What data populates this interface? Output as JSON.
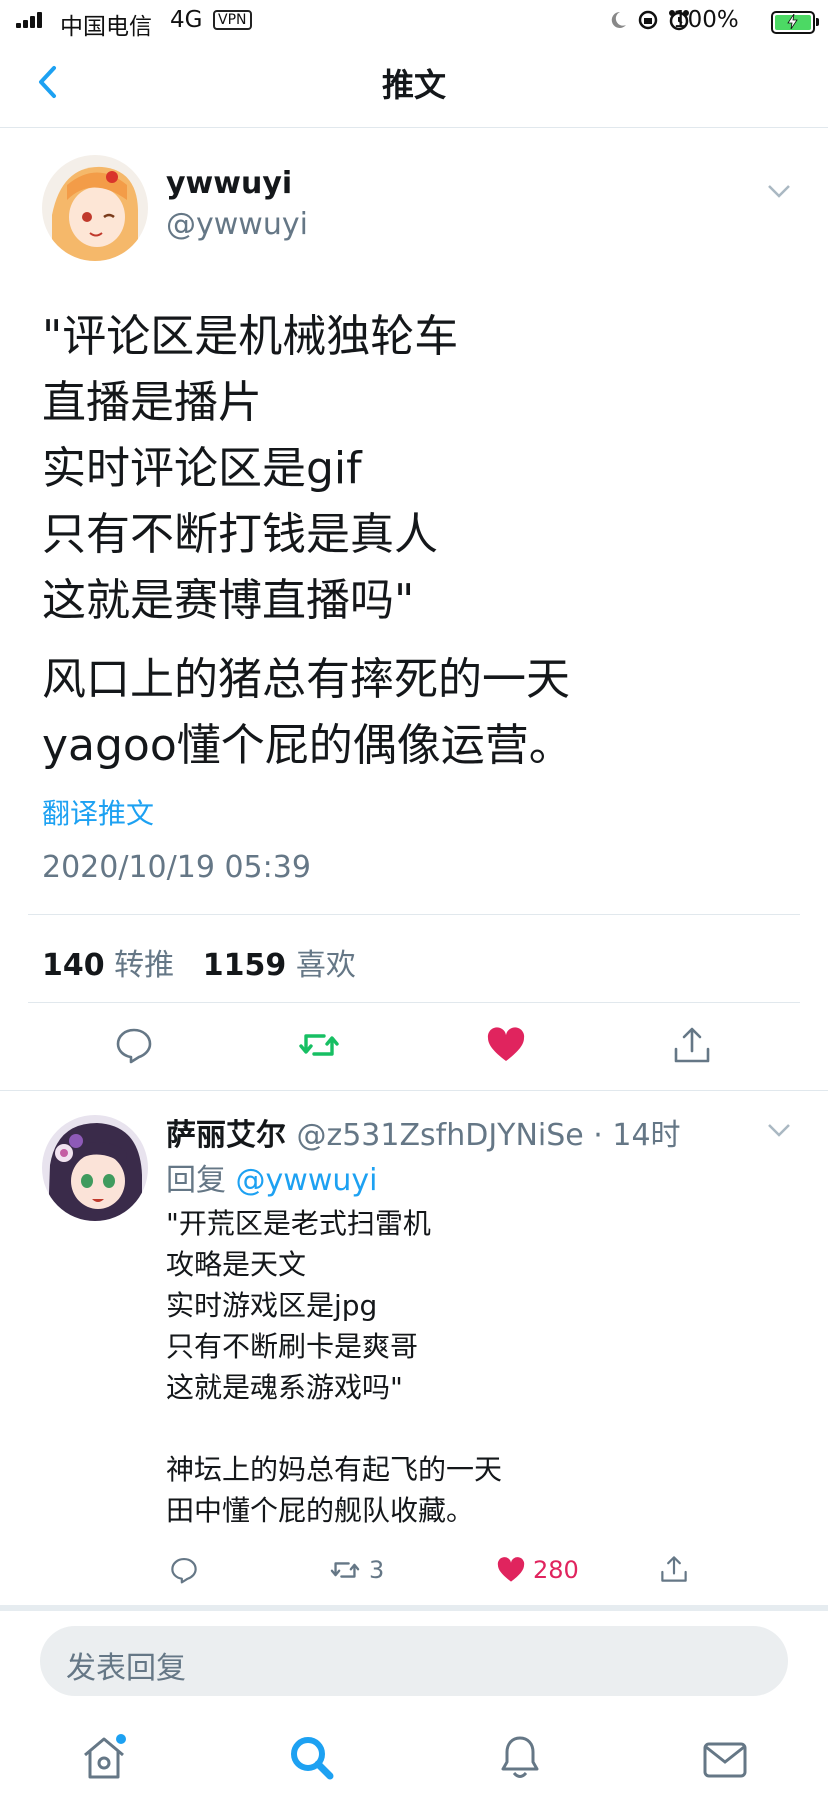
{
  "status_bar": {
    "carrier": "中国电信",
    "network": "4G",
    "vpn": "VPN",
    "battery_pct": "100%",
    "battery_level": 1.0
  },
  "nav": {
    "title": "推文"
  },
  "tweet": {
    "author_name": "ywwuyi",
    "author_handle": "@ywwuyi",
    "paragraph1": "\"评论区是机械独轮车\n直播是播片\n实时评论区是gif\n只有不断打钱是真人\n这就是赛博直播吗\"",
    "paragraph2": "风口上的猪总有摔死的一天\nyagoo懂个屁的偶像运营。",
    "translate_label": "翻译推文",
    "timestamp": "2020/10/19 05:39",
    "retweet_count": "140",
    "retweet_label": "转推",
    "like_count": "1159",
    "like_label": "喜欢"
  },
  "reply": {
    "author_name": "萨丽艾尔",
    "author_handle_time": "@z531ZsfhDJYNiSe · 14时",
    "reply_prefix": "回复",
    "reply_to": "@ywwuyi",
    "text": "\"开荒区是老式扫雷机\n攻略是天文\n实时游戏区是jpg\n只有不断刷卡是爽哥\n这就是魂系游戏吗\"\n\n神坛上的妈总有起飞的一天\n田中懂个屁的舰队收藏。",
    "retweet_count": "3",
    "like_count": "280"
  },
  "composer": {
    "placeholder": "发表回复"
  },
  "tabs": [
    "home",
    "search",
    "notifications",
    "messages"
  ],
  "colors": {
    "accent": "#1da1f2",
    "retweet": "#17bf63",
    "like": "#e0245e",
    "reply_like": "#e0245e"
  }
}
